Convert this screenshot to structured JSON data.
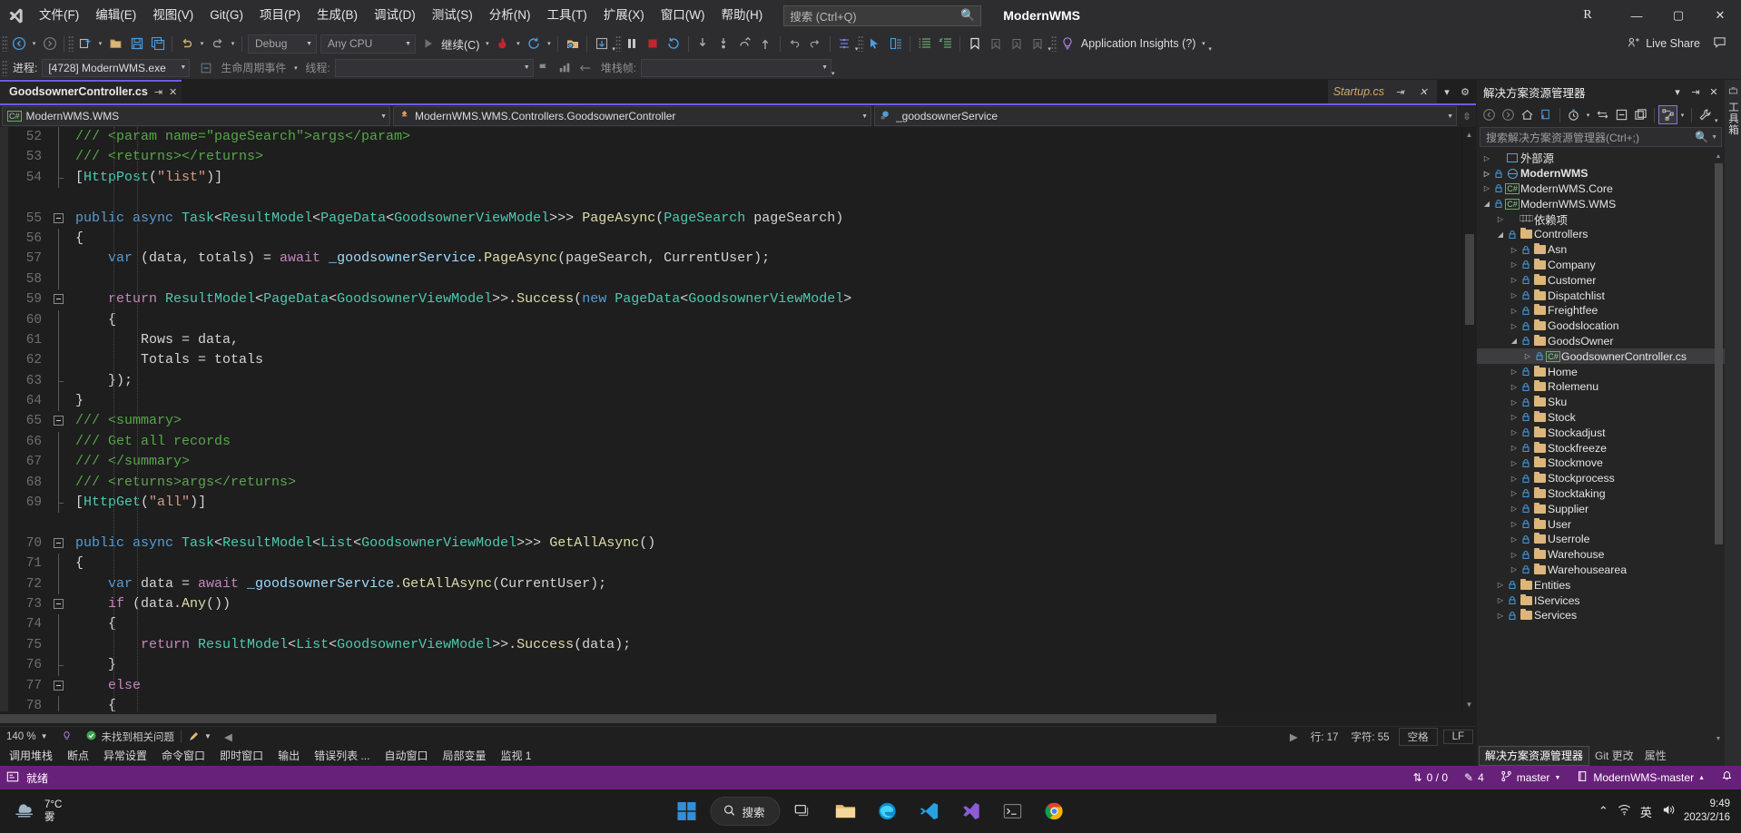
{
  "titlebar": {
    "logo_icon": "visual-studio-logo",
    "menus": [
      "文件(F)",
      "编辑(E)",
      "视图(V)",
      "Git(G)",
      "项目(P)",
      "生成(B)",
      "调试(D)",
      "测试(S)",
      "分析(N)",
      "工具(T)",
      "扩展(X)",
      "窗口(W)",
      "帮助(H)"
    ],
    "search_placeholder": "搜索 (Ctrl+Q)",
    "search_icon": "search-icon",
    "app_name": "ModernWMS",
    "account_initial": "R",
    "minimize": "—",
    "maximize": "▢",
    "close": "✕"
  },
  "toolbar": {
    "nav_back": "back-icon",
    "nav_forward": "forward-icon",
    "new_project": "new-project-icon",
    "open_file": "open-file-icon",
    "save": "save-icon",
    "save_all": "save-all-icon",
    "undo": "undo-icon",
    "redo": "redo-icon",
    "config_label": "Debug",
    "platform_label": "Any CPU",
    "run_label": "继续(C)",
    "run_icon": "play-icon",
    "hot_reload_icon": "hot-reload-icon",
    "restart_icon": "restart-icon",
    "breakpoint_icon": "breakpoint-icon",
    "pause_icon": "pause-icon",
    "stop_icon": "stop-icon",
    "restart_debug_icon": "restart-debug-icon",
    "step_into_icon": "step-into-icon",
    "step_over_icon": "step-over-icon",
    "step_out_icon": "step-out-icon",
    "app_insights_label": "Application Insights (?)",
    "app_insights_icon": "lightbulb-icon"
  },
  "debugbar": {
    "process_label": "进程:",
    "process_value": "[4728] ModernWMS.exe",
    "lifecycle_label": "生命周期事件",
    "thread_label": "线程:",
    "thread_value": "",
    "stack_label": "堆栈帧:",
    "stack_value": ""
  },
  "editor": {
    "tabs": [
      {
        "name": "GoodsownerController.cs",
        "active": true,
        "pin_icon": "pin-icon",
        "close_icon": "close-icon"
      }
    ],
    "preview_tab": {
      "name": "Startup.cs",
      "pin_icon": "pin-icon",
      "close_icon": "close-icon"
    },
    "tabstrip_overflow_icon": "chevron-down-icon",
    "tabstrip_settings_icon": "gear-icon",
    "navbar": {
      "project": "ModernWMS.WMS",
      "project_icon": "csharp-project-icon",
      "type": "ModernWMS.WMS.Controllers.GoodsownerController",
      "type_icon": "class-icon",
      "member": "_goodsownerService",
      "member_icon": "field-icon",
      "splitter_icon": "split-window-icon"
    },
    "lines": [
      {
        "n": "52",
        "fold": "",
        "tokens": [
          [
            "cm",
            "/// <param name=\"pageSearch\">args</param>"
          ]
        ]
      },
      {
        "n": "53",
        "fold": "",
        "tokens": [
          [
            "cm",
            "/// <returns></returns>"
          ]
        ]
      },
      {
        "n": "54",
        "fold": "end",
        "tokens": [
          [
            "pl",
            "["
          ],
          [
            "kc",
            "HttpPost"
          ],
          [
            "pl",
            "("
          ],
          [
            "st",
            "\"list\""
          ],
          [
            "pl",
            ")]"
          ]
        ]
      },
      {
        "n": "",
        "fold": "",
        "tokens": []
      },
      {
        "n": "55",
        "fold": "open",
        "tokens": [
          [
            "k",
            "public "
          ],
          [
            "k",
            "async "
          ],
          [
            "kc",
            "Task"
          ],
          [
            "pl",
            "<"
          ],
          [
            "kc",
            "ResultModel"
          ],
          [
            "pl",
            "<"
          ],
          [
            "kc",
            "PageData"
          ],
          [
            "pl",
            "<"
          ],
          [
            "kc",
            "GoodsownerViewModel"
          ],
          [
            "pl",
            ">>> "
          ],
          [
            "mt",
            "PageAsync"
          ],
          [
            "pl",
            "("
          ],
          [
            "kc",
            "PageSearch"
          ],
          [
            "pl",
            " pageSearch)"
          ]
        ]
      },
      {
        "n": "56",
        "fold": "",
        "tokens": [
          [
            "pl",
            "{"
          ]
        ]
      },
      {
        "n": "57",
        "fold": "",
        "tokens": [
          [
            "k",
            "    var "
          ],
          [
            "pl",
            "(data, totals) = "
          ],
          [
            "ct",
            "await "
          ],
          [
            "id",
            "_goodsownerService"
          ],
          [
            "pl",
            "."
          ],
          [
            "mt",
            "PageAsync"
          ],
          [
            "pl",
            "(pageSearch, CurrentUser);"
          ]
        ]
      },
      {
        "n": "58",
        "fold": "",
        "tokens": []
      },
      {
        "n": "59",
        "fold": "open",
        "tokens": [
          [
            "ct",
            "    return "
          ],
          [
            "kc",
            "ResultModel"
          ],
          [
            "pl",
            "<"
          ],
          [
            "kc",
            "PageData"
          ],
          [
            "pl",
            "<"
          ],
          [
            "kc",
            "GoodsownerViewModel"
          ],
          [
            "pl",
            ">>."
          ],
          [
            "mt",
            "Success"
          ],
          [
            "pl",
            "("
          ],
          [
            "k",
            "new "
          ],
          [
            "kc",
            "PageData"
          ],
          [
            "pl",
            "<"
          ],
          [
            "kc",
            "GoodsownerViewModel"
          ],
          [
            "pl",
            ">"
          ]
        ]
      },
      {
        "n": "60",
        "fold": "",
        "tokens": [
          [
            "pl",
            "    {"
          ]
        ]
      },
      {
        "n": "61",
        "fold": "",
        "tokens": [
          [
            "pl",
            "        Rows = data,"
          ]
        ]
      },
      {
        "n": "62",
        "fold": "",
        "tokens": [
          [
            "pl",
            "        Totals = totals"
          ]
        ]
      },
      {
        "n": "63",
        "fold": "end",
        "tokens": [
          [
            "pl",
            "    });"
          ]
        ]
      },
      {
        "n": "64",
        "fold": "",
        "tokens": [
          [
            "pl",
            "}"
          ]
        ]
      },
      {
        "n": "65",
        "fold": "open",
        "tokens": [
          [
            "cm",
            "/// <summary>"
          ]
        ]
      },
      {
        "n": "66",
        "fold": "",
        "tokens": [
          [
            "cm",
            "/// Get all records"
          ]
        ]
      },
      {
        "n": "67",
        "fold": "",
        "tokens": [
          [
            "cm",
            "/// </summary>"
          ]
        ]
      },
      {
        "n": "68",
        "fold": "",
        "tokens": [
          [
            "cm",
            "/// <returns>args</returns>"
          ]
        ]
      },
      {
        "n": "69",
        "fold": "end",
        "tokens": [
          [
            "pl",
            "["
          ],
          [
            "kc",
            "HttpGet"
          ],
          [
            "pl",
            "("
          ],
          [
            "st",
            "\"all\""
          ],
          [
            "pl",
            ")]"
          ]
        ]
      },
      {
        "n": "",
        "fold": "",
        "tokens": []
      },
      {
        "n": "70",
        "fold": "open",
        "tokens": [
          [
            "k",
            "public "
          ],
          [
            "k",
            "async "
          ],
          [
            "kc",
            "Task"
          ],
          [
            "pl",
            "<"
          ],
          [
            "kc",
            "ResultModel"
          ],
          [
            "pl",
            "<"
          ],
          [
            "kc",
            "List"
          ],
          [
            "pl",
            "<"
          ],
          [
            "kc",
            "GoodsownerViewModel"
          ],
          [
            "pl",
            ">>> "
          ],
          [
            "mt",
            "GetAllAsync"
          ],
          [
            "pl",
            "()"
          ]
        ]
      },
      {
        "n": "71",
        "fold": "",
        "tokens": [
          [
            "pl",
            "{"
          ]
        ]
      },
      {
        "n": "72",
        "fold": "",
        "tokens": [
          [
            "k",
            "    var "
          ],
          [
            "pl",
            "data = "
          ],
          [
            "ct",
            "await "
          ],
          [
            "id",
            "_goodsownerService"
          ],
          [
            "pl",
            "."
          ],
          [
            "mt",
            "GetAllAsync"
          ],
          [
            "pl",
            "(CurrentUser);"
          ]
        ]
      },
      {
        "n": "73",
        "fold": "open",
        "tokens": [
          [
            "ct",
            "    if "
          ],
          [
            "pl",
            "(data."
          ],
          [
            "mt",
            "Any"
          ],
          [
            "pl",
            "())"
          ]
        ]
      },
      {
        "n": "74",
        "fold": "",
        "tokens": [
          [
            "pl",
            "    {"
          ]
        ]
      },
      {
        "n": "75",
        "fold": "",
        "tokens": [
          [
            "ct",
            "        return "
          ],
          [
            "kc",
            "ResultModel"
          ],
          [
            "pl",
            "<"
          ],
          [
            "kc",
            "List"
          ],
          [
            "pl",
            "<"
          ],
          [
            "kc",
            "GoodsownerViewModel"
          ],
          [
            "pl",
            ">>."
          ],
          [
            "mt",
            "Success"
          ],
          [
            "pl",
            "(data);"
          ]
        ]
      },
      {
        "n": "76",
        "fold": "end",
        "tokens": [
          [
            "pl",
            "    }"
          ]
        ]
      },
      {
        "n": "77",
        "fold": "open",
        "tokens": [
          [
            "ct",
            "    else"
          ]
        ]
      },
      {
        "n": "78",
        "fold": "",
        "tokens": [
          [
            "pl",
            "    {"
          ]
        ]
      }
    ],
    "status": {
      "zoom": "140 %",
      "zoom_arrow": "▾",
      "issues_icon": "check-circle-icon",
      "issues_text": "未找到相关问题",
      "brush_icon": "brush-icon",
      "prev_icon": "◀",
      "line_label": "行: 17",
      "col_label": "字符: 55",
      "spaces_label": "空格",
      "eol_label": "LF",
      "expand_icon": "▶"
    },
    "dock_tabs": [
      "调用堆栈",
      "断点",
      "异常设置",
      "命令窗口",
      "即时窗口",
      "输出",
      "错误列表 ...",
      "自动窗口",
      "局部变量",
      "监视 1"
    ]
  },
  "solution_explorer": {
    "title": "解决方案资源管理器",
    "header_icons": [
      "chevron-down-icon",
      "pin-icon",
      "close-icon"
    ],
    "toolbar_icons": [
      "back-icon",
      "forward-icon",
      "home-icon",
      "sync-with-active-icon",
      "pending-changes-icon",
      "collapse-all-icon",
      "show-all-files-icon",
      "properties-icon",
      "view-class-diagram-icon",
      "wrench-icon"
    ],
    "search_placeholder": "搜索解决方案资源管理器(Ctrl+;)",
    "search_icon": "search-icon",
    "tree": [
      {
        "label": "外部源",
        "depth": 0,
        "twisty": "collapsed",
        "icon": "external-sources",
        "lock": false,
        "bold": false,
        "selected": false
      },
      {
        "label": "ModernWMS",
        "depth": 0,
        "twisty": "collapsed",
        "icon": "web-project",
        "lock": true,
        "bold": true,
        "selected": false
      },
      {
        "label": "ModernWMS.Core",
        "depth": 0,
        "twisty": "collapsed",
        "icon": "csharp",
        "lock": true,
        "bold": false,
        "selected": false
      },
      {
        "label": "ModernWMS.WMS",
        "depth": 0,
        "twisty": "expanded",
        "icon": "csharp",
        "lock": true,
        "bold": false,
        "selected": false
      },
      {
        "label": "依赖项",
        "depth": 1,
        "twisty": "collapsed",
        "icon": "dependencies",
        "lock": false,
        "bold": false,
        "selected": false
      },
      {
        "label": "Controllers",
        "depth": 1,
        "twisty": "expanded",
        "icon": "folder",
        "lock": true,
        "bold": false,
        "selected": false
      },
      {
        "label": "Asn",
        "depth": 2,
        "twisty": "collapsed",
        "icon": "folder",
        "lock": true,
        "bold": false,
        "selected": false
      },
      {
        "label": "Company",
        "depth": 2,
        "twisty": "collapsed",
        "icon": "folder",
        "lock": true,
        "bold": false,
        "selected": false
      },
      {
        "label": "Customer",
        "depth": 2,
        "twisty": "collapsed",
        "icon": "folder",
        "lock": true,
        "bold": false,
        "selected": false
      },
      {
        "label": "Dispatchlist",
        "depth": 2,
        "twisty": "collapsed",
        "icon": "folder",
        "lock": true,
        "bold": false,
        "selected": false
      },
      {
        "label": "Freightfee",
        "depth": 2,
        "twisty": "collapsed",
        "icon": "folder",
        "lock": true,
        "bold": false,
        "selected": false
      },
      {
        "label": "Goodslocation",
        "depth": 2,
        "twisty": "collapsed",
        "icon": "folder",
        "lock": true,
        "bold": false,
        "selected": false
      },
      {
        "label": "GoodsOwner",
        "depth": 2,
        "twisty": "expanded",
        "icon": "folder",
        "lock": true,
        "bold": false,
        "selected": false
      },
      {
        "label": "GoodsownerController.cs",
        "depth": 3,
        "twisty": "collapsed",
        "icon": "csharp",
        "lock": true,
        "bold": false,
        "selected": true
      },
      {
        "label": "Home",
        "depth": 2,
        "twisty": "collapsed",
        "icon": "folder",
        "lock": true,
        "bold": false,
        "selected": false
      },
      {
        "label": "Rolemenu",
        "depth": 2,
        "twisty": "collapsed",
        "icon": "folder",
        "lock": true,
        "bold": false,
        "selected": false
      },
      {
        "label": "Sku",
        "depth": 2,
        "twisty": "collapsed",
        "icon": "folder",
        "lock": true,
        "bold": false,
        "selected": false
      },
      {
        "label": "Stock",
        "depth": 2,
        "twisty": "collapsed",
        "icon": "folder",
        "lock": true,
        "bold": false,
        "selected": false
      },
      {
        "label": "Stockadjust",
        "depth": 2,
        "twisty": "collapsed",
        "icon": "folder",
        "lock": true,
        "bold": false,
        "selected": false
      },
      {
        "label": "Stockfreeze",
        "depth": 2,
        "twisty": "collapsed",
        "icon": "folder",
        "lock": true,
        "bold": false,
        "selected": false
      },
      {
        "label": "Stockmove",
        "depth": 2,
        "twisty": "collapsed",
        "icon": "folder",
        "lock": true,
        "bold": false,
        "selected": false
      },
      {
        "label": "Stockprocess",
        "depth": 2,
        "twisty": "collapsed",
        "icon": "folder",
        "lock": true,
        "bold": false,
        "selected": false
      },
      {
        "label": "Stocktaking",
        "depth": 2,
        "twisty": "collapsed",
        "icon": "folder",
        "lock": true,
        "bold": false,
        "selected": false
      },
      {
        "label": "Supplier",
        "depth": 2,
        "twisty": "collapsed",
        "icon": "folder",
        "lock": true,
        "bold": false,
        "selected": false
      },
      {
        "label": "User",
        "depth": 2,
        "twisty": "collapsed",
        "icon": "folder",
        "lock": true,
        "bold": false,
        "selected": false
      },
      {
        "label": "Userrole",
        "depth": 2,
        "twisty": "collapsed",
        "icon": "folder",
        "lock": true,
        "bold": false,
        "selected": false
      },
      {
        "label": "Warehouse",
        "depth": 2,
        "twisty": "collapsed",
        "icon": "folder",
        "lock": true,
        "bold": false,
        "selected": false
      },
      {
        "label": "Warehousearea",
        "depth": 2,
        "twisty": "collapsed",
        "icon": "folder",
        "lock": true,
        "bold": false,
        "selected": false
      },
      {
        "label": "Entities",
        "depth": 1,
        "twisty": "collapsed",
        "icon": "folder",
        "lock": true,
        "bold": false,
        "selected": false
      },
      {
        "label": "IServices",
        "depth": 1,
        "twisty": "collapsed",
        "icon": "folder",
        "lock": true,
        "bold": false,
        "selected": false
      },
      {
        "label": "Services",
        "depth": 1,
        "twisty": "collapsed",
        "icon": "folder",
        "lock": true,
        "bold": false,
        "selected": false
      }
    ],
    "footer_tabs": [
      {
        "label": "解决方案资源管理器",
        "active": true
      },
      {
        "label": "Git 更改",
        "active": false
      },
      {
        "label": "属性",
        "active": false
      }
    ],
    "vertical_strip_label": "工具箱"
  },
  "vs_status": {
    "ready_icon": "ready-icon",
    "ready_text": "就绪",
    "changes_icon": "arrows-icon",
    "changes_text": "0 / 0",
    "pencil_icon": "pencil-icon",
    "pencil_count": "4",
    "branch_icon": "branch-icon",
    "branch_name": "master",
    "repo_icon": "repo-icon",
    "repo_name": "ModernWMS-master",
    "notify_icon": "bell-icon",
    "live_share": "Live Share",
    "live_share_icon": "live-share-icon",
    "feedback_icon": "feedback-icon",
    "accent_color": "#68217a"
  },
  "taskbar": {
    "weather_temp": "7°C",
    "weather_desc": "雾",
    "weather_icon": "fog-icon",
    "start_icon": "windows-start-icon",
    "search_label": "搜索",
    "search_icon": "search-icon",
    "apps": [
      "task-view-icon",
      "file-explorer-icon",
      "edge-icon",
      "vscode-icon",
      "visual-studio-icon",
      "terminal-icon",
      "chrome-icon"
    ],
    "tray_icons": [
      "chevron-up-icon",
      "network-icon",
      "ime-icon",
      "volume-icon"
    ],
    "ime_label": "英",
    "clock_time": "9:49",
    "clock_date": "2023/2/16"
  }
}
